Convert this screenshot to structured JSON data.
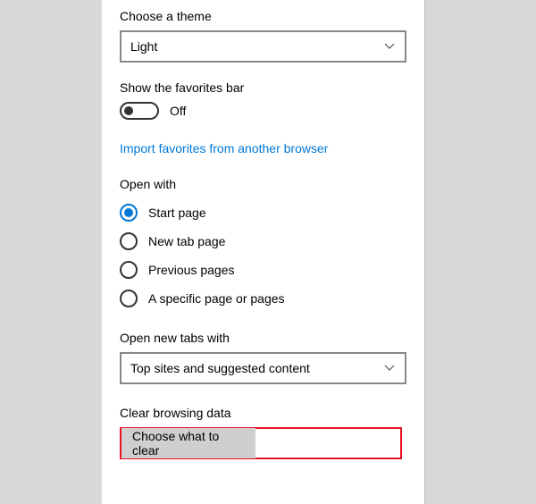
{
  "theme": {
    "label": "Choose a theme",
    "value": "Light"
  },
  "favorites_bar": {
    "label": "Show the favorites bar",
    "state": "Off"
  },
  "import_link": "Import favorites from another browser",
  "open_with": {
    "label": "Open with",
    "options": [
      "Start page",
      "New tab page",
      "Previous pages",
      "A specific page or pages"
    ],
    "selected_index": 0
  },
  "new_tabs": {
    "label": "Open new tabs with",
    "value": "Top sites and suggested content"
  },
  "clear_data": {
    "label": "Clear browsing data",
    "button": "Choose what to clear"
  }
}
